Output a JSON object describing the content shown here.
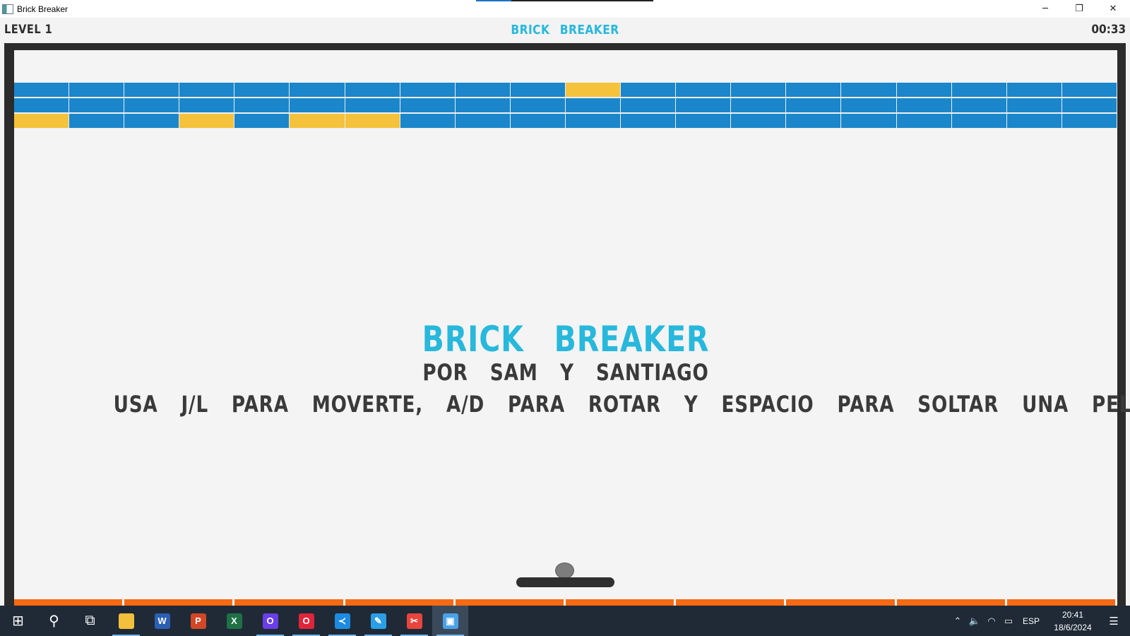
{
  "window": {
    "title": "Brick Breaker",
    "controls": {
      "minimize": "─",
      "restore": "❐",
      "close": "✕"
    },
    "progress_fraction": 0.2
  },
  "hud": {
    "level": "LEVEL 1",
    "title": "BRICK BREAKER",
    "timer": "00:33"
  },
  "overlay": {
    "title": "BRICK BREAKER",
    "credits": "POR SAM Y SANTIAGO",
    "instructions": "USA J/L PARA MOVERTE, A/D PARA ROTAR Y ESPACIO PARA SOLTAR UNA PELOTA."
  },
  "colors": {
    "brick_blue": "#1b86c9",
    "brick_yellow": "#f5c23c",
    "title_cyan": "#27b8dc",
    "floor_orange": "#f66a13"
  },
  "bricks": {
    "rows": [
      [
        "blue",
        "blue",
        "blue",
        "blue",
        "blue",
        "blue",
        "blue",
        "blue",
        "blue",
        "blue",
        "yellow",
        "blue",
        "blue",
        "blue",
        "blue",
        "blue",
        "blue",
        "blue",
        "blue",
        "blue"
      ],
      [
        "blue",
        "blue",
        "blue",
        "blue",
        "blue",
        "blue",
        "blue",
        "blue",
        "blue",
        "blue",
        "blue",
        "blue",
        "blue",
        "blue",
        "blue",
        "blue",
        "blue",
        "blue",
        "blue",
        "blue"
      ],
      [
        "yellow",
        "blue",
        "blue",
        "yellow",
        "blue",
        "yellow",
        "yellow",
        "blue",
        "blue",
        "blue",
        "blue",
        "blue",
        "blue",
        "blue",
        "blue",
        "blue",
        "blue",
        "blue",
        "blue",
        "blue"
      ]
    ]
  },
  "floor": {
    "segments": 10
  },
  "taskbar": {
    "items": [
      {
        "name": "start-button",
        "icon": "windows-icon",
        "glyph": "⊞",
        "color": "#ffffff",
        "running": false
      },
      {
        "name": "search-button",
        "icon": "search-icon",
        "glyph": "⚲",
        "color": "#ffffff",
        "running": false
      },
      {
        "name": "task-view-button",
        "icon": "task-view-icon",
        "glyph": "⧉",
        "color": "#ffffff",
        "running": false
      },
      {
        "name": "file-explorer",
        "icon": "folder-icon",
        "glyph": "",
        "color": "#f3c03b",
        "running": true
      },
      {
        "name": "word",
        "icon": "word-icon",
        "glyph": "W",
        "color": "#2b5fb4",
        "running": false
      },
      {
        "name": "powerpoint",
        "icon": "powerpoint-icon",
        "glyph": "P",
        "color": "#d24726",
        "running": false
      },
      {
        "name": "excel",
        "icon": "excel-icon",
        "glyph": "X",
        "color": "#1e7145",
        "running": false
      },
      {
        "name": "opera-gx",
        "icon": "opera-gx-icon",
        "glyph": "O",
        "color": "#6a3ee8",
        "running": true
      },
      {
        "name": "opera",
        "icon": "opera-icon",
        "glyph": "O",
        "color": "#e0243a",
        "running": true
      },
      {
        "name": "vscode",
        "icon": "vscode-icon",
        "glyph": "≺",
        "color": "#1d8be0",
        "running": true
      },
      {
        "name": "paint",
        "icon": "paint-icon",
        "glyph": "✎",
        "color": "#2a9ee6",
        "running": true
      },
      {
        "name": "snipping-tool",
        "icon": "snipping-tool-icon",
        "glyph": "✂",
        "color": "#e8453c",
        "running": true
      },
      {
        "name": "brick-breaker",
        "icon": "app-window-icon",
        "glyph": "▣",
        "color": "#4aa3e8",
        "running": true,
        "active": true
      }
    ],
    "tray": {
      "icons": [
        {
          "name": "show-hidden-icons",
          "glyph": "⌃"
        },
        {
          "name": "volume-icon",
          "glyph": "🔈"
        },
        {
          "name": "wifi-icon",
          "glyph": "◠"
        },
        {
          "name": "battery-icon",
          "glyph": "▭"
        }
      ],
      "language": "ESP",
      "time": "20:41",
      "date": "18/6/2024",
      "notifications_glyph": "☰"
    }
  }
}
